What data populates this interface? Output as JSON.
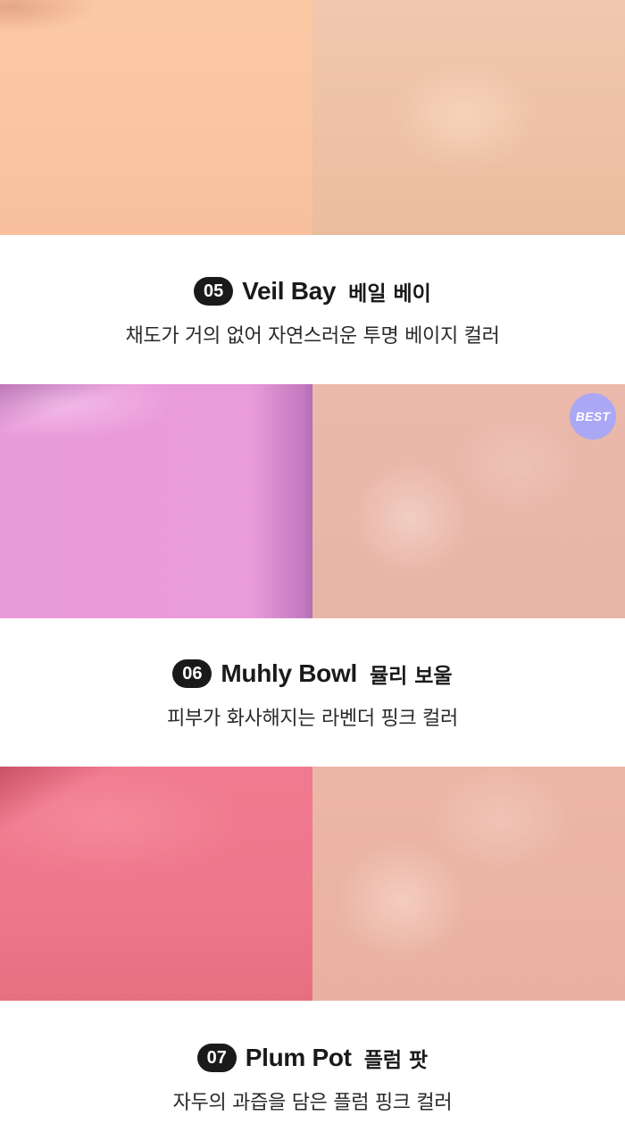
{
  "badge": {
    "best_label": "BEST"
  },
  "shades": [
    {
      "number": "05",
      "name_en": "Veil Bay",
      "name_ko": "베일 베이",
      "description": "채도가 거의 없어 자연스러운 투명 베이지 컬러",
      "texture_color": "#fbc6a3",
      "skin_color": "#edc1a5"
    },
    {
      "number": "06",
      "name_en": "Muhly Bowl",
      "name_ko": "뮬리 보울",
      "description": "피부가 화사해지는 라벤더 핑크 컬러",
      "texture_color": "#ea9bd9",
      "skin_color": "#e8b4a6"
    },
    {
      "number": "07",
      "name_en": "Plum Pot",
      "name_ko": "플럼 팟",
      "description": "자두의 과즙을 담은 플럼 핑크 컬러",
      "texture_color": "#ee778c",
      "skin_color": "#e9b1a0"
    }
  ],
  "colors": {
    "number_badge_bg": "#1a1a1a",
    "best_badge_bg": "#aaa8f4"
  }
}
